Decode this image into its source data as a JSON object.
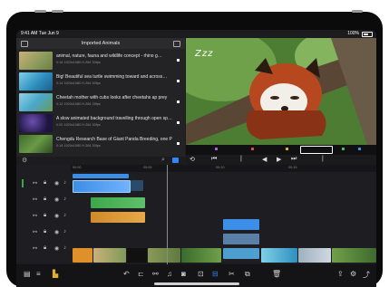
{
  "status": {
    "time": "9:41 AM",
    "date": "Tue Jun 9",
    "battery": "100%"
  },
  "library": {
    "title": "Imported Animals",
    "clips": [
      {
        "title": "animal, nature, fauna and wildlife concept - rhino g…",
        "meta": "0:16  1920x1080  H.264  30fps"
      },
      {
        "title": "Big! Beautiful sea turtle swimming toward and across…",
        "meta": "0:14  1920x1080  H.264  30fps"
      },
      {
        "title": "Cheetah mother with cubs looks after cheetahs ap prey",
        "meta": "0:12  1920x1080  H.264  25fps"
      },
      {
        "title": "A slow animated background travelling through open sp…",
        "meta": "0:20  1920x1080  H.264  30fps"
      },
      {
        "title": "Chengdu Research Base of Giant Panda Breeding, one P…",
        "meta": "0:18  1920x1080  H.264  30fps"
      }
    ]
  },
  "preview": {
    "caption": "Zzz"
  },
  "ruler": {
    "marks": [
      "00:00",
      "00:05",
      "00:10",
      "00:15"
    ]
  },
  "colors": {
    "accent": "#2f86ff",
    "clip_blue": "#3d8ee6",
    "clip_green": "#39a845",
    "clip_orange": "#e0902b",
    "audio": "#1a5b37"
  },
  "icons": [
    "library-icon",
    "add-icon",
    "search-icon",
    "play-icon",
    "skip-back-icon",
    "skip-forward-icon",
    "lock-icon",
    "link-icon",
    "eye-icon",
    "speaker-icon",
    "undo-icon",
    "scissors-icon",
    "trash-icon",
    "share-icon",
    "settings-icon"
  ]
}
